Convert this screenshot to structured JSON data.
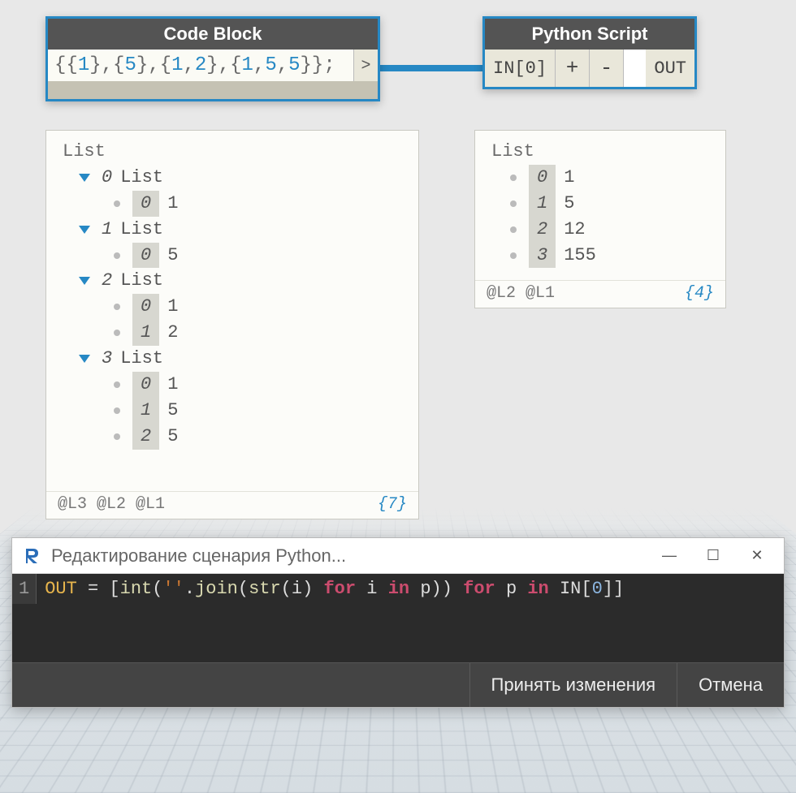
{
  "node_code": {
    "title": "Code Block",
    "expr_parts": [
      "{{",
      "1",
      "},{",
      "5",
      "},{",
      "1",
      ",",
      "2",
      "},{",
      "1",
      ",",
      "5",
      ",",
      "5",
      "}};"
    ],
    "out_caret": ">"
  },
  "node_py": {
    "title": "Python Script",
    "in_label": "IN[0]",
    "plus": "+",
    "minus": "-",
    "out_label": "OUT"
  },
  "watch1": {
    "root": "List",
    "groups": [
      {
        "idx": "0",
        "label": "List",
        "items": [
          {
            "i": "0",
            "v": "1"
          }
        ]
      },
      {
        "idx": "1",
        "label": "List",
        "items": [
          {
            "i": "0",
            "v": "5"
          }
        ]
      },
      {
        "idx": "2",
        "label": "List",
        "items": [
          {
            "i": "0",
            "v": "1"
          },
          {
            "i": "1",
            "v": "2"
          }
        ]
      },
      {
        "idx": "3",
        "label": "List",
        "items": [
          {
            "i": "0",
            "v": "1"
          },
          {
            "i": "1",
            "v": "5"
          },
          {
            "i": "2",
            "v": "5"
          }
        ]
      }
    ],
    "footer_left": "@L3 @L2 @L1",
    "footer_count": "{7}"
  },
  "watch2": {
    "root": "List",
    "items": [
      {
        "i": "0",
        "v": "1"
      },
      {
        "i": "1",
        "v": "5"
      },
      {
        "i": "2",
        "v": "12"
      },
      {
        "i": "3",
        "v": "155"
      }
    ],
    "footer_left": "@L2 @L1",
    "footer_count": "{4}"
  },
  "editor": {
    "title": "Редактирование сценария Python...",
    "line_no": "1",
    "accept": "Принять изменения",
    "cancel": "Отмена"
  }
}
